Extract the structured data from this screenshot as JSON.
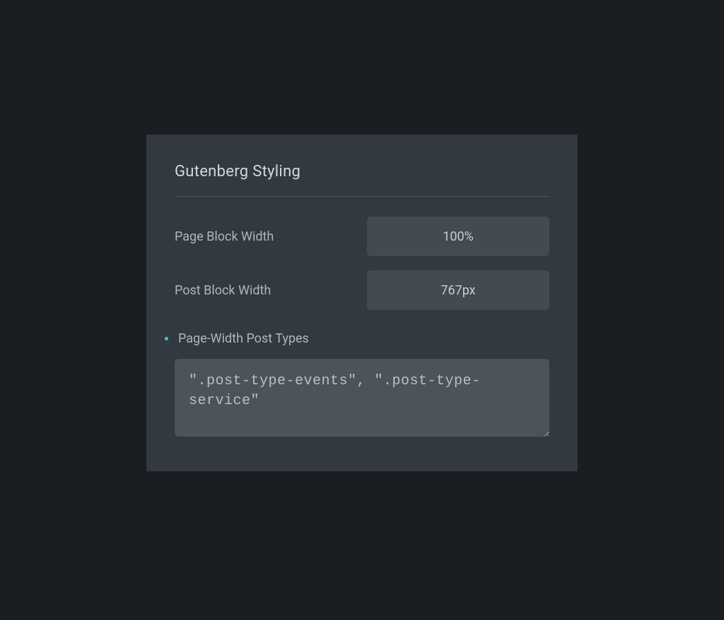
{
  "panel": {
    "title": "Gutenberg Styling",
    "fields": {
      "pageBlockWidth": {
        "label": "Page Block Width",
        "value": "100%"
      },
      "postBlockWidth": {
        "label": "Post Block Width",
        "value": "767px"
      },
      "pageWidthPostTypes": {
        "label": "Page-Width Post Types",
        "value": "\".post-type-events\", \".post-type-service\""
      }
    }
  }
}
